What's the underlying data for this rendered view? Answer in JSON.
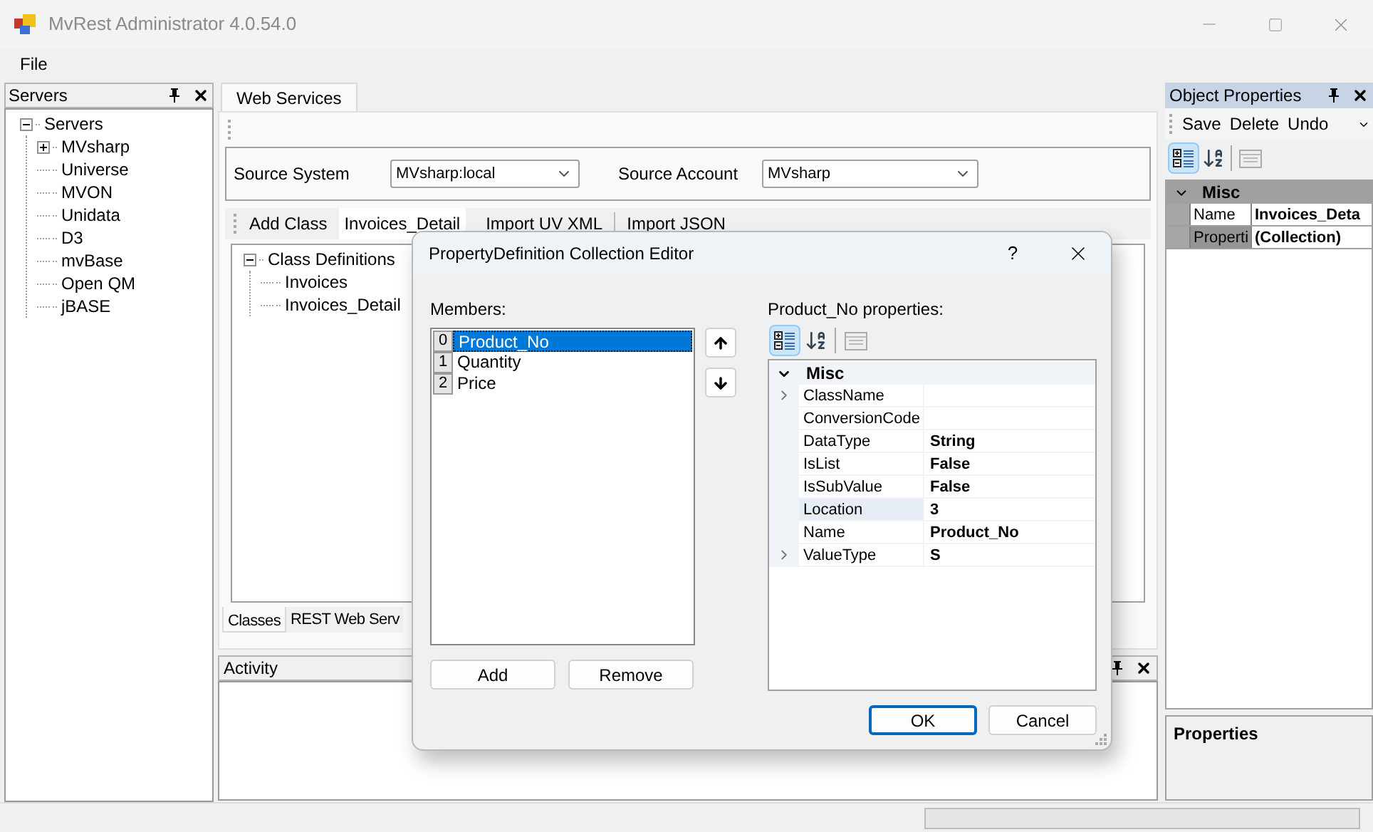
{
  "window": {
    "title": "MvRest Administrator 4.0.54.0"
  },
  "menu": [
    {
      "label": "File"
    }
  ],
  "servers_panel": {
    "title": "Servers",
    "tree": [
      {
        "label": "Servers",
        "expanded": true,
        "children": [
          {
            "label": "MVsharp",
            "expanded": false
          },
          {
            "label": "Universe"
          },
          {
            "label": "MVON"
          },
          {
            "label": "Unidata"
          },
          {
            "label": "D3"
          },
          {
            "label": "mvBase"
          },
          {
            "label": "Open QM"
          },
          {
            "label": "jBASE"
          }
        ]
      }
    ]
  },
  "tabs": [
    {
      "label": "Web Services",
      "selected": true
    }
  ],
  "source": {
    "system_label": "Source System",
    "system_value": "MVsharp:local",
    "account_label": "Source Account",
    "account_value": "MVsharp"
  },
  "class_toolbar": [
    {
      "kind": "button",
      "label": "Add Class"
    },
    {
      "kind": "field",
      "label": "Invoices_Detail"
    },
    {
      "kind": "button",
      "label": "Import UV XML"
    },
    {
      "kind": "separator"
    },
    {
      "kind": "button",
      "label": "Import JSON"
    }
  ],
  "class_tree": [
    {
      "label": "Class Definitions",
      "expanded": true,
      "children": [
        {
          "label": "Invoices"
        },
        {
          "label": "Invoices_Detail"
        }
      ]
    }
  ],
  "bottom_tabs": [
    {
      "label": "Classes",
      "selected": true
    },
    {
      "label": "REST Web Serv",
      "selected": false
    }
  ],
  "activity": {
    "title": "Activity"
  },
  "object_properties": {
    "title": "Object Properties",
    "toolbar": [
      "Save",
      "Delete",
      "Undo"
    ],
    "category": "Misc",
    "rows": [
      {
        "name": "Name",
        "value": "Invoices_Deta",
        "selected": false
      },
      {
        "name": "Properti",
        "value": "(Collection)",
        "selected": true
      }
    ],
    "description_title": "Properties"
  },
  "dialog": {
    "title": "PropertyDefinition Collection Editor",
    "help": "?",
    "members_label": "Members:",
    "members": [
      {
        "index": "0",
        "name": "Product_No",
        "selected": true
      },
      {
        "index": "1",
        "name": "Quantity",
        "selected": false
      },
      {
        "index": "2",
        "name": "Price",
        "selected": false
      }
    ],
    "add": "Add",
    "remove": "Remove",
    "properties_label": "Product_No properties:",
    "category": "Misc",
    "rows": [
      {
        "name": "ClassName",
        "value": "",
        "expandable": true,
        "selected": false
      },
      {
        "name": "ConversionCode",
        "value": "",
        "expandable": false,
        "selected": false
      },
      {
        "name": "DataType",
        "value": "String",
        "expandable": false,
        "selected": false
      },
      {
        "name": "IsList",
        "value": "False",
        "expandable": false,
        "selected": false
      },
      {
        "name": "IsSubValue",
        "value": "False",
        "expandable": false,
        "selected": false
      },
      {
        "name": "Location",
        "value": "3",
        "expandable": false,
        "selected": true
      },
      {
        "name": "Name",
        "value": "Product_No",
        "expandable": false,
        "selected": false
      },
      {
        "name": "ValueType",
        "value": "S",
        "expandable": true,
        "selected": false
      }
    ],
    "ok": "OK",
    "cancel": "Cancel"
  },
  "status_bar": {
    "progress": {
      "level": 0
    }
  }
}
